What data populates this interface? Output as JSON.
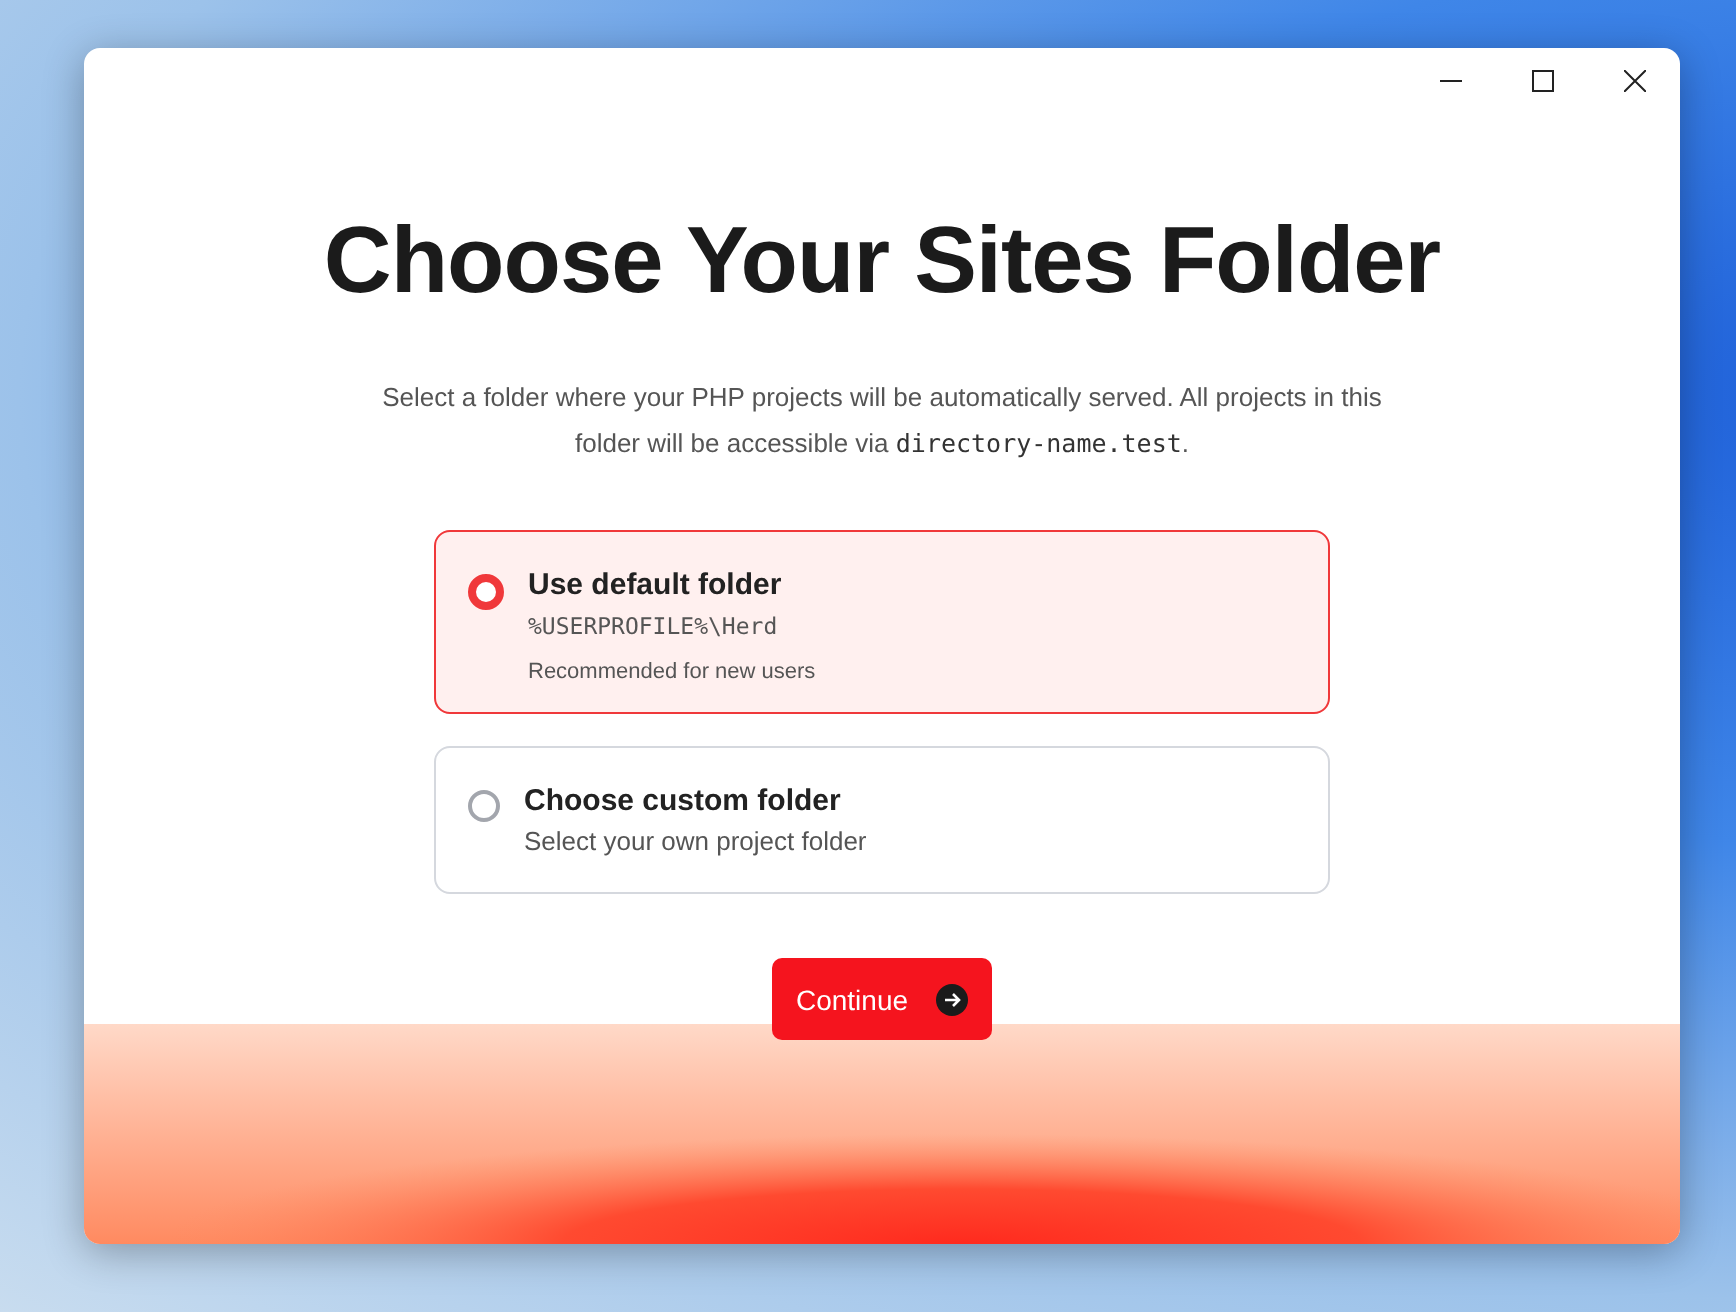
{
  "window": {
    "controls": [
      {
        "kind": "minimize"
      },
      {
        "kind": "maximize"
      },
      {
        "kind": "close"
      }
    ]
  },
  "heading": "Choose Your Sites Folder",
  "description": {
    "text": "Select a folder where your PHP projects will be automatically served. All projects in this folder will be accessible via ",
    "code": "directory-name.test",
    "after": "."
  },
  "options": [
    {
      "title": "Use default folder",
      "selected": true,
      "lines": [
        {
          "kind": "mono",
          "text": "%USERPROFILE%\\Herd"
        },
        {
          "kind": "note",
          "text": "Recommended for new users"
        }
      ]
    },
    {
      "title": "Choose custom folder",
      "selected": false,
      "lines": [
        {
          "kind": "plain",
          "text": "Select your own project folder"
        }
      ]
    }
  ],
  "button": {
    "label": "Continue"
  }
}
